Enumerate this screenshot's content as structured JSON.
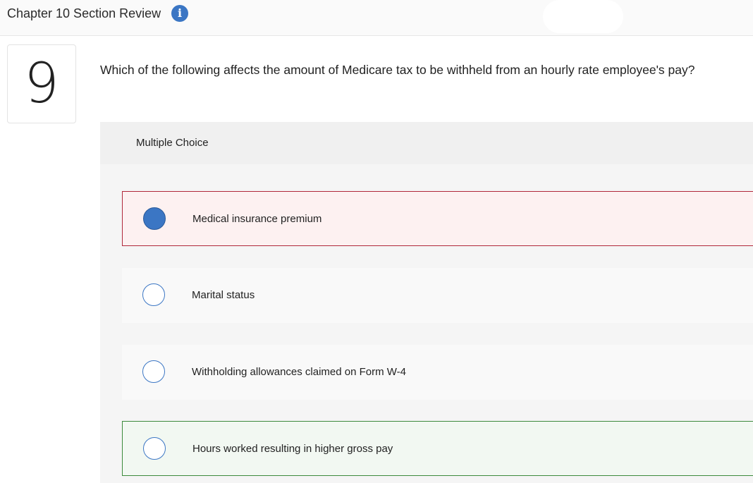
{
  "header": {
    "title": "Chapter 10 Section Review",
    "info_icon": "info-icon"
  },
  "question": {
    "number": "9",
    "text": "Which of the following affects the amount of Medicare tax to be withheld from an hourly rate employee's pay?"
  },
  "multiple_choice": {
    "label": "Multiple Choice",
    "options": [
      {
        "label": "Medical insurance premium",
        "selected": true,
        "state": "incorrect"
      },
      {
        "label": "Marital status",
        "selected": false,
        "state": "neutral"
      },
      {
        "label": "Withholding allowances claimed on Form W-4",
        "selected": false,
        "state": "neutral"
      },
      {
        "label": "Hours worked resulting in higher gross pay",
        "selected": false,
        "state": "correct"
      }
    ]
  },
  "colors": {
    "accent": "#3b76c4",
    "incorrect_border": "#b0283a",
    "incorrect_bg": "#fdf1f1",
    "correct_border": "#3c8a3c",
    "correct_bg": "#f2f8f2"
  }
}
